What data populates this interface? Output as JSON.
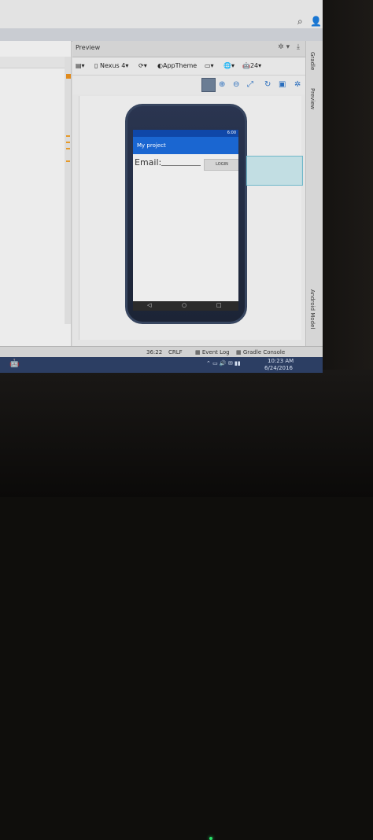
{
  "preview": {
    "title": "Preview",
    "toolbar": {
      "device": "Nexus 4",
      "theme": "AppTheme",
      "api": "24"
    }
  },
  "phone": {
    "status_time": "6:00",
    "app_title": "My project",
    "email_label": "Email:",
    "login_label": "LOGIN",
    "nav_back": "◁",
    "nav_home": "○",
    "nav_recent": "□"
  },
  "side_tabs": {
    "gradle": "Gradle",
    "preview": "Preview",
    "android_model": "Android Model"
  },
  "statusbar": {
    "position": "36:22",
    "line_sep": "CRLF",
    "event_log": "Event Log",
    "gradle_console": "Gradle Console"
  },
  "taskbar": {
    "time": "10:23 AM",
    "date": "6/24/2016"
  }
}
